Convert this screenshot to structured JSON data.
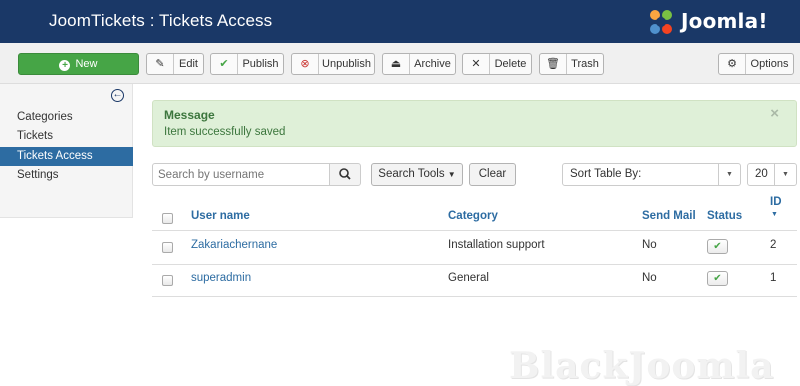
{
  "header": {
    "title": "JoomTickets : Tickets Access",
    "logo_text": "Joomla!"
  },
  "toolbar": {
    "new": "New",
    "edit": "Edit",
    "publish": "Publish",
    "unpublish": "Unpublish",
    "archive": "Archive",
    "delete": "Delete",
    "trash": "Trash",
    "options": "Options"
  },
  "sidebar": {
    "items": [
      {
        "label": "Categories",
        "active": false
      },
      {
        "label": "Tickets",
        "active": false
      },
      {
        "label": "Tickets Access",
        "active": true
      },
      {
        "label": "Settings",
        "active": false
      }
    ]
  },
  "message": {
    "heading": "Message",
    "text": "Item successfully saved",
    "close": "×"
  },
  "filters": {
    "search_placeholder": "Search by username",
    "search_tools": "Search Tools",
    "clear": "Clear",
    "sort_label": "Sort Table By:",
    "limit": "20"
  },
  "table": {
    "columns": {
      "username": "User name",
      "category": "Category",
      "send_mail": "Send Mail",
      "status": "Status",
      "id": "ID"
    },
    "rows": [
      {
        "username": "Zakariachernane",
        "category": "Installation support",
        "send_mail": "No",
        "status": "published",
        "id": "2"
      },
      {
        "username": "superadmin",
        "category": "General",
        "send_mail": "No",
        "status": "published",
        "id": "1"
      }
    ]
  },
  "watermark": "BlackJoomla",
  "colors": {
    "header_bg": "#1a3867",
    "new_button": "#46a546",
    "active_nav": "#2d6ca2",
    "alert_bg": "#dff0d8",
    "link": "#2d6ca2"
  }
}
